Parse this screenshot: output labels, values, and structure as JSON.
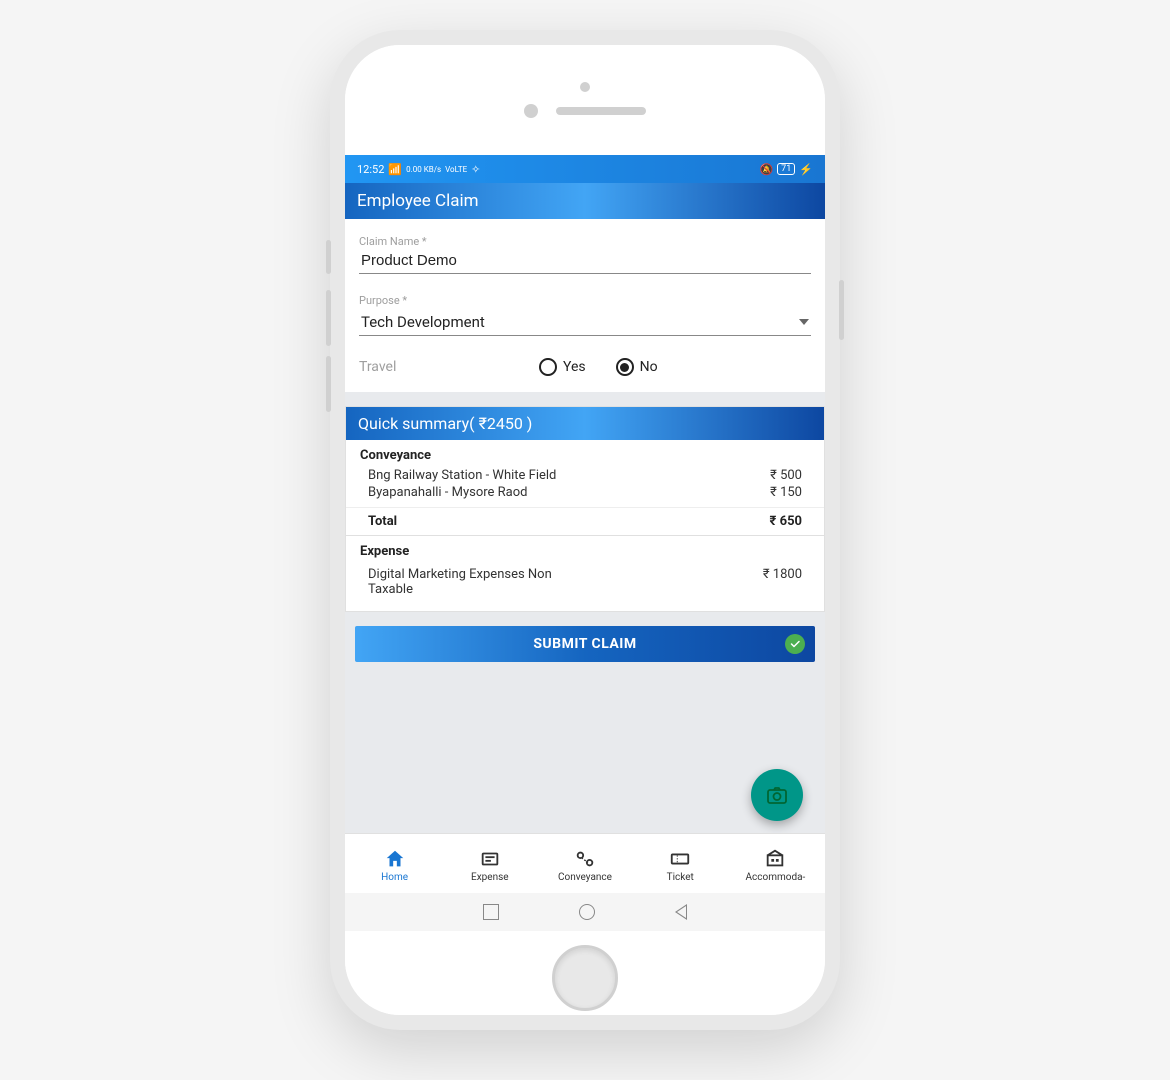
{
  "statusbar": {
    "time": "12:52",
    "signal_text": "4G",
    "net_text": "0.00 KB/s",
    "volte": "VoLTE",
    "battery": "71"
  },
  "header": {
    "title": "Employee Claim"
  },
  "form": {
    "claim_name_label": "Claim Name *",
    "claim_name_value": "Product Demo",
    "purpose_label": "Purpose *",
    "purpose_value": "Tech Development",
    "travel_label": "Travel",
    "yes_label": "Yes",
    "no_label": "No",
    "travel_selected": "No"
  },
  "summary": {
    "header": "Quick summary( ₹2450 )",
    "conveyance_title": "Conveyance",
    "conveyance_items": [
      {
        "desc": "Bng Railway  Station - White Field",
        "amt": "₹ 500"
      },
      {
        "desc": "Byapanahalli - Mysore Raod",
        "amt": "₹ 150"
      }
    ],
    "total_label": "Total",
    "total_amt": "₹ 650",
    "expense_title": "Expense",
    "expense_items": [
      {
        "desc": "Digital Marketing Expenses Non Taxable",
        "amt": "₹ 1800"
      }
    ]
  },
  "submit": {
    "label": "SUBMIT CLAIM"
  },
  "nav": {
    "items": [
      {
        "label": "Home"
      },
      {
        "label": "Expense"
      },
      {
        "label": "Conveyance"
      },
      {
        "label": "Ticket"
      },
      {
        "label": "Accommoda-"
      }
    ]
  }
}
